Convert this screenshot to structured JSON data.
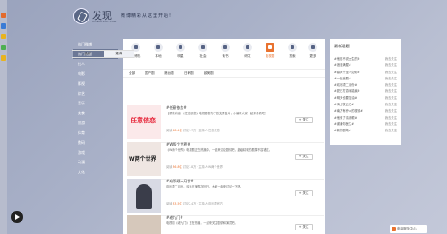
{
  "header": {
    "logo_text": "发现",
    "logo_sub": "XUNMISHE.COM",
    "slogan": "微博精彩从这里开始!"
  },
  "left_nav": {
    "items": [
      "热门微博",
      "热门话题",
      "找人",
      "电影",
      "影视",
      "综艺",
      "音乐",
      "美食",
      "旅游",
      "体育",
      "数码",
      "游戏",
      "动漫",
      "文化"
    ],
    "active_index": 1
  },
  "categories": {
    "items": [
      "微博热",
      "本地",
      "明星",
      "社会",
      "读书",
      "研发",
      "电视剧",
      "搜索",
      "更多"
    ],
    "active_index": 6
  },
  "subtabs": [
    "全部",
    "国产剧",
    "港台剧",
    "日韩剧",
    "欧美剧"
  ],
  "toggle": {
    "items": [
      "全部",
      "推荐"
    ],
    "active_index": 1
  },
  "follow_label": "+ 关注",
  "topics": [
    {
      "title": "#任意依恋#",
      "desc": "【重磅消息】《任意依恋》电视剧发布了首支预告片，小编带大家一起来看看吧！",
      "reads_label": "阅读",
      "reads": "28.4亿",
      "discuss": "讨论1.7万 · 主持人:任意依恋",
      "thumb_text": "任意依恋"
    },
    {
      "title": "#W两个世界#",
      "desc": "《W两个世界》电视剧正在热播中，一起来讨论剧情吧，超级精彩的剧集不容错过。",
      "reads_label": "阅读",
      "reads": "36.8亿",
      "discuss": "讨论1.8万 · 主持人:W两个世界",
      "thumb_text": "W两个世界"
    },
    {
      "title": "#欢乐颂二月份#",
      "desc": "欢乐颂二月份，欢乐五美再次回归，大家一起来讨论一下吧。",
      "reads_label": "阅读",
      "reads": "33.5亿",
      "discuss": "讨论2.4万 · 主持人:欢乐颂官方",
      "thumb_text": ""
    },
    {
      "title": "#老九门#",
      "desc": "电视剧《老九门》正在热播，一起来关注剧情和演员吧。",
      "reads_label": "阅读",
      "reads": "28.1亿",
      "discuss": "讨论1.2万",
      "thumb_text": ""
    }
  ],
  "right_panel": {
    "title": "最新话题",
    "follow_label": "我去关注",
    "rows": [
      "#他是不说女生的#",
      "#浪漫满屋#",
      "#春风十里不如你#",
      "#一起追剧#",
      "#欢乐颂二月份#",
      "#夏日打游戏能赢#",
      "#明天也要加油#",
      "#海上牧云记#",
      "#南方有乔木的视频#",
      "#他来了请闭眼#",
      "#谢谢你医生#",
      "#新热剧场#"
    ]
  },
  "tray": {
    "label": "电脑服务中心"
  },
  "colors": {
    "accent": "#e9722f",
    "nav_bg": "#6c7896",
    "page_bg": "#a9b1c8"
  }
}
